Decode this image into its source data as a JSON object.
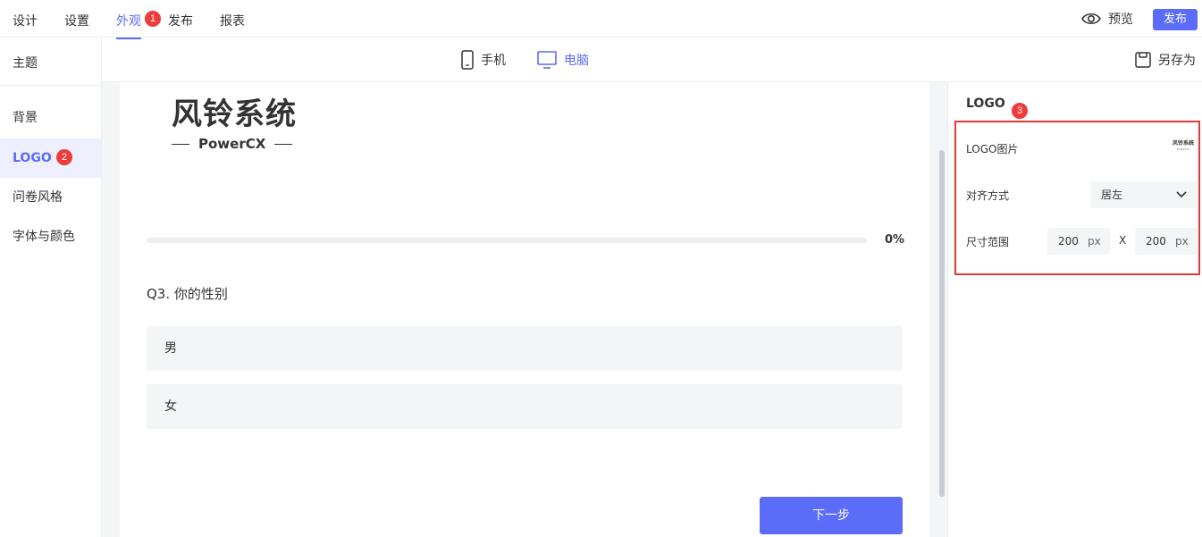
{
  "topnav": {
    "tabs": [
      {
        "label": "设计"
      },
      {
        "label": "设置"
      },
      {
        "label": "外观",
        "badge": "1"
      },
      {
        "label": "发布"
      },
      {
        "label": "报表"
      }
    ],
    "preview_label": "预览",
    "publish_label": "发布"
  },
  "sidebar": {
    "theme_label": "主题",
    "items": [
      {
        "label": "背景"
      },
      {
        "label": "LOGO",
        "badge": "2"
      },
      {
        "label": "问卷风格"
      },
      {
        "label": "字体与颜色"
      }
    ]
  },
  "devices": {
    "mobile_label": "手机",
    "desktop_label": "电脑",
    "save_as_label": "另存为"
  },
  "canvas": {
    "logo_main": "风铃系统",
    "logo_sub": "PowerCX",
    "progress_percent": 0,
    "progress_label": "0%",
    "question": "Q3.  你的性别",
    "options": [
      "男",
      "女"
    ],
    "next_label": "下一步"
  },
  "panel": {
    "title": "LOGO",
    "badge": "3",
    "logo_image_label": "LOGO图片",
    "logo_thumb_text": "风铃系统",
    "logo_thumb_sub": "PowerCX",
    "align_label": "对齐方式",
    "align_value": "居左",
    "size_label": "尺寸范围",
    "width_value": "200",
    "height_value": "200",
    "unit": "px",
    "times": "X"
  },
  "colors": {
    "accent": "#5b6cf9",
    "badge": "#ee3b3b",
    "highlight_box": "#e53935"
  }
}
